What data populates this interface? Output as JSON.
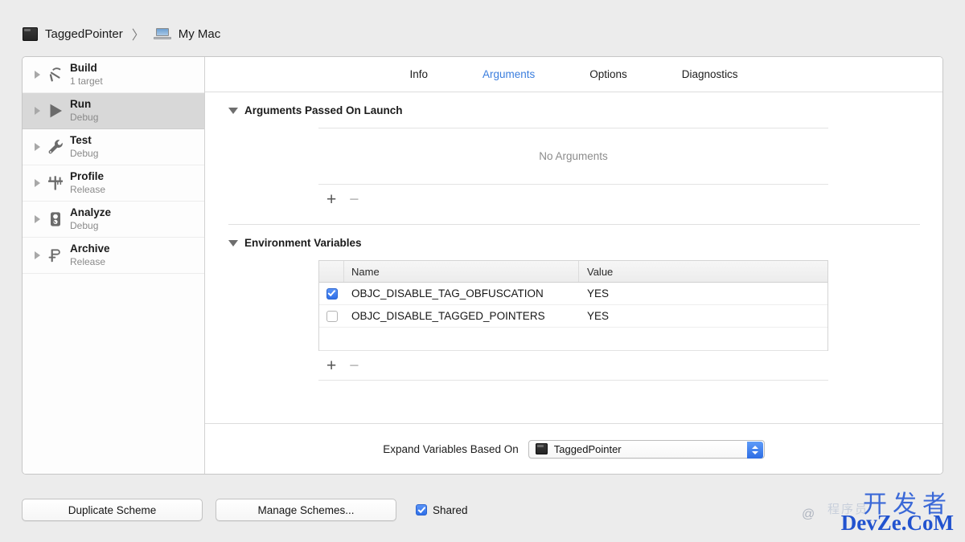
{
  "breadcrumb": {
    "project": "TaggedPointer",
    "separator": "〉",
    "destination": "My Mac"
  },
  "sidebar": {
    "items": [
      {
        "name": "Build",
        "sub": "1 target",
        "icon": "hammer-icon",
        "selected": false
      },
      {
        "name": "Run",
        "sub": "Debug",
        "icon": "play-icon",
        "selected": true
      },
      {
        "name": "Test",
        "sub": "Debug",
        "icon": "wrench-icon",
        "selected": false
      },
      {
        "name": "Profile",
        "sub": "Release",
        "icon": "calipers-icon",
        "selected": false
      },
      {
        "name": "Analyze",
        "sub": "Debug",
        "icon": "analyze-icon",
        "selected": false
      },
      {
        "name": "Archive",
        "sub": "Release",
        "icon": "archive-icon",
        "selected": false
      }
    ]
  },
  "tabs": [
    {
      "label": "Info",
      "active": false
    },
    {
      "label": "Arguments",
      "active": true
    },
    {
      "label": "Options",
      "active": false
    },
    {
      "label": "Diagnostics",
      "active": false
    }
  ],
  "arguments_section": {
    "title": "Arguments Passed On Launch",
    "empty_text": "No Arguments",
    "add_label": "+",
    "remove_label": "−"
  },
  "env_section": {
    "title": "Environment Variables",
    "columns": [
      "Name",
      "Value"
    ],
    "rows": [
      {
        "checked": true,
        "name": "OBJC_DISABLE_TAG_OBFUSCATION",
        "value": "YES"
      },
      {
        "checked": false,
        "name": "OBJC_DISABLE_TAGGED_POINTERS",
        "value": "YES"
      }
    ],
    "add_label": "+",
    "remove_label": "−"
  },
  "expand_bar": {
    "label": "Expand Variables Based On",
    "selected": "TaggedPointer"
  },
  "bottom_bar": {
    "duplicate_label": "Duplicate Scheme",
    "manage_label": "Manage Schemes...",
    "shared_label": "Shared",
    "shared_checked": true
  },
  "watermark": {
    "cn": "开发者",
    "en": "DevZe.CoM",
    "at": "@",
    "ghost": "程序员"
  },
  "colors": {
    "accent": "#3b7ede",
    "checkbox": "#2f6fe8",
    "selection": "#d8d8d8",
    "background": "#ececec"
  }
}
